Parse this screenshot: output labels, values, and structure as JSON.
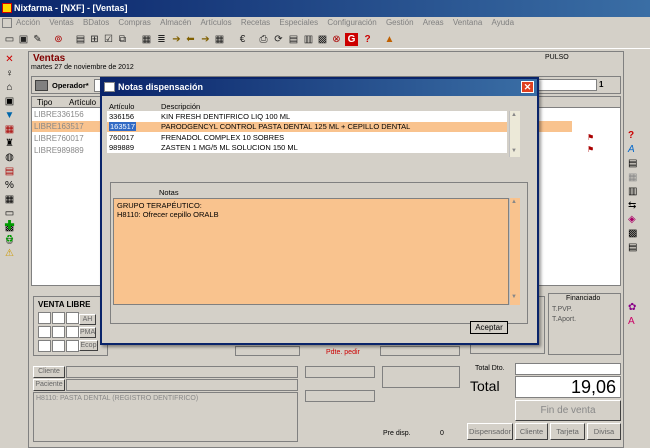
{
  "app": {
    "title": "Nixfarma - [NXF] - [Ventas]"
  },
  "menu": [
    "Acción",
    "Ventas",
    "BDatos",
    "Compras",
    "Almacén",
    "Artículos",
    "Recetas",
    "Especiales",
    "Configuración",
    "Gestión",
    "Areas",
    "Ventana",
    "Ayuda"
  ],
  "ventas": {
    "title": "Ventas",
    "date": "martes 27 de noviembre de 2012",
    "pulso": "PULSO",
    "operador_label": "Operador*",
    "operador_code": "1"
  },
  "grid": {
    "headers": [
      "Tipo",
      "Artículo"
    ],
    "rows": [
      {
        "tipo": "LIBRE",
        "articulo": "336156",
        "selected": false
      },
      {
        "tipo": "LIBRE",
        "articulo": "163517",
        "selected": true
      },
      {
        "tipo": "LIBRE",
        "articulo": "760017",
        "selected": false
      },
      {
        "tipo": "LIBRE",
        "articulo": "989889",
        "selected": false
      }
    ]
  },
  "bottom": {
    "venta_libre": "VENTA LIBRE",
    "ah": "AH",
    "pma": "PMA",
    "ecop": "Ecop",
    "pdte_pedir": "Pdte. pedir",
    "cliente_btn": "Cliente",
    "paciente_btn": "Paciente",
    "info_line": "H8110: PASTA DENTAL (REGISTRO DENTIFRICO)",
    "financiado": "Financiado",
    "t_pvp": "T.PVP.",
    "t_aport": "T.Aport.",
    "total_dto": "Total Dto.",
    "total_label": "Total",
    "total_value": "19,06",
    "pre_disp": "Pre disp.",
    "pre_disp_value": "0",
    "fin_venta": "Fin de venta",
    "dispensador": "Dispensador",
    "cliente": "Cliente",
    "tarjeta": "Tarjeta",
    "divisa": "Divisa"
  },
  "dialog": {
    "title": "Notas dispensación",
    "col_articulo": "Artículo",
    "col_descripcion": "Descripción",
    "rows": [
      {
        "articulo": "336156",
        "descripcion": "KIN FRESH DENTIFRICO LIQ 100 ML",
        "selected": false
      },
      {
        "articulo": "163517",
        "descripcion": "PARODGENCYL CONTROL PASTA DENTAL 125 ML + CEPILLO DENTAL",
        "selected": true
      },
      {
        "articulo": "760017",
        "descripcion": "FRENADOL COMPLEX 10 SOBRES",
        "selected": false
      },
      {
        "articulo": "989889",
        "descripcion": "ZASTEN 1 MG/5 ML SOLUCION 150 ML",
        "selected": false
      }
    ],
    "notes_label": "Notas",
    "notes_text": "GRUPO TERAPÉUTICO:\nH8110: Ofrecer cepillo ORALB",
    "aceptar": "Aceptar"
  },
  "colors": {
    "accent": "#0a246a",
    "selected_row": "#f9c38e",
    "highlight": "#316ac5",
    "ventas_title": "#800000",
    "pdte_pedir": "#cc0000"
  }
}
